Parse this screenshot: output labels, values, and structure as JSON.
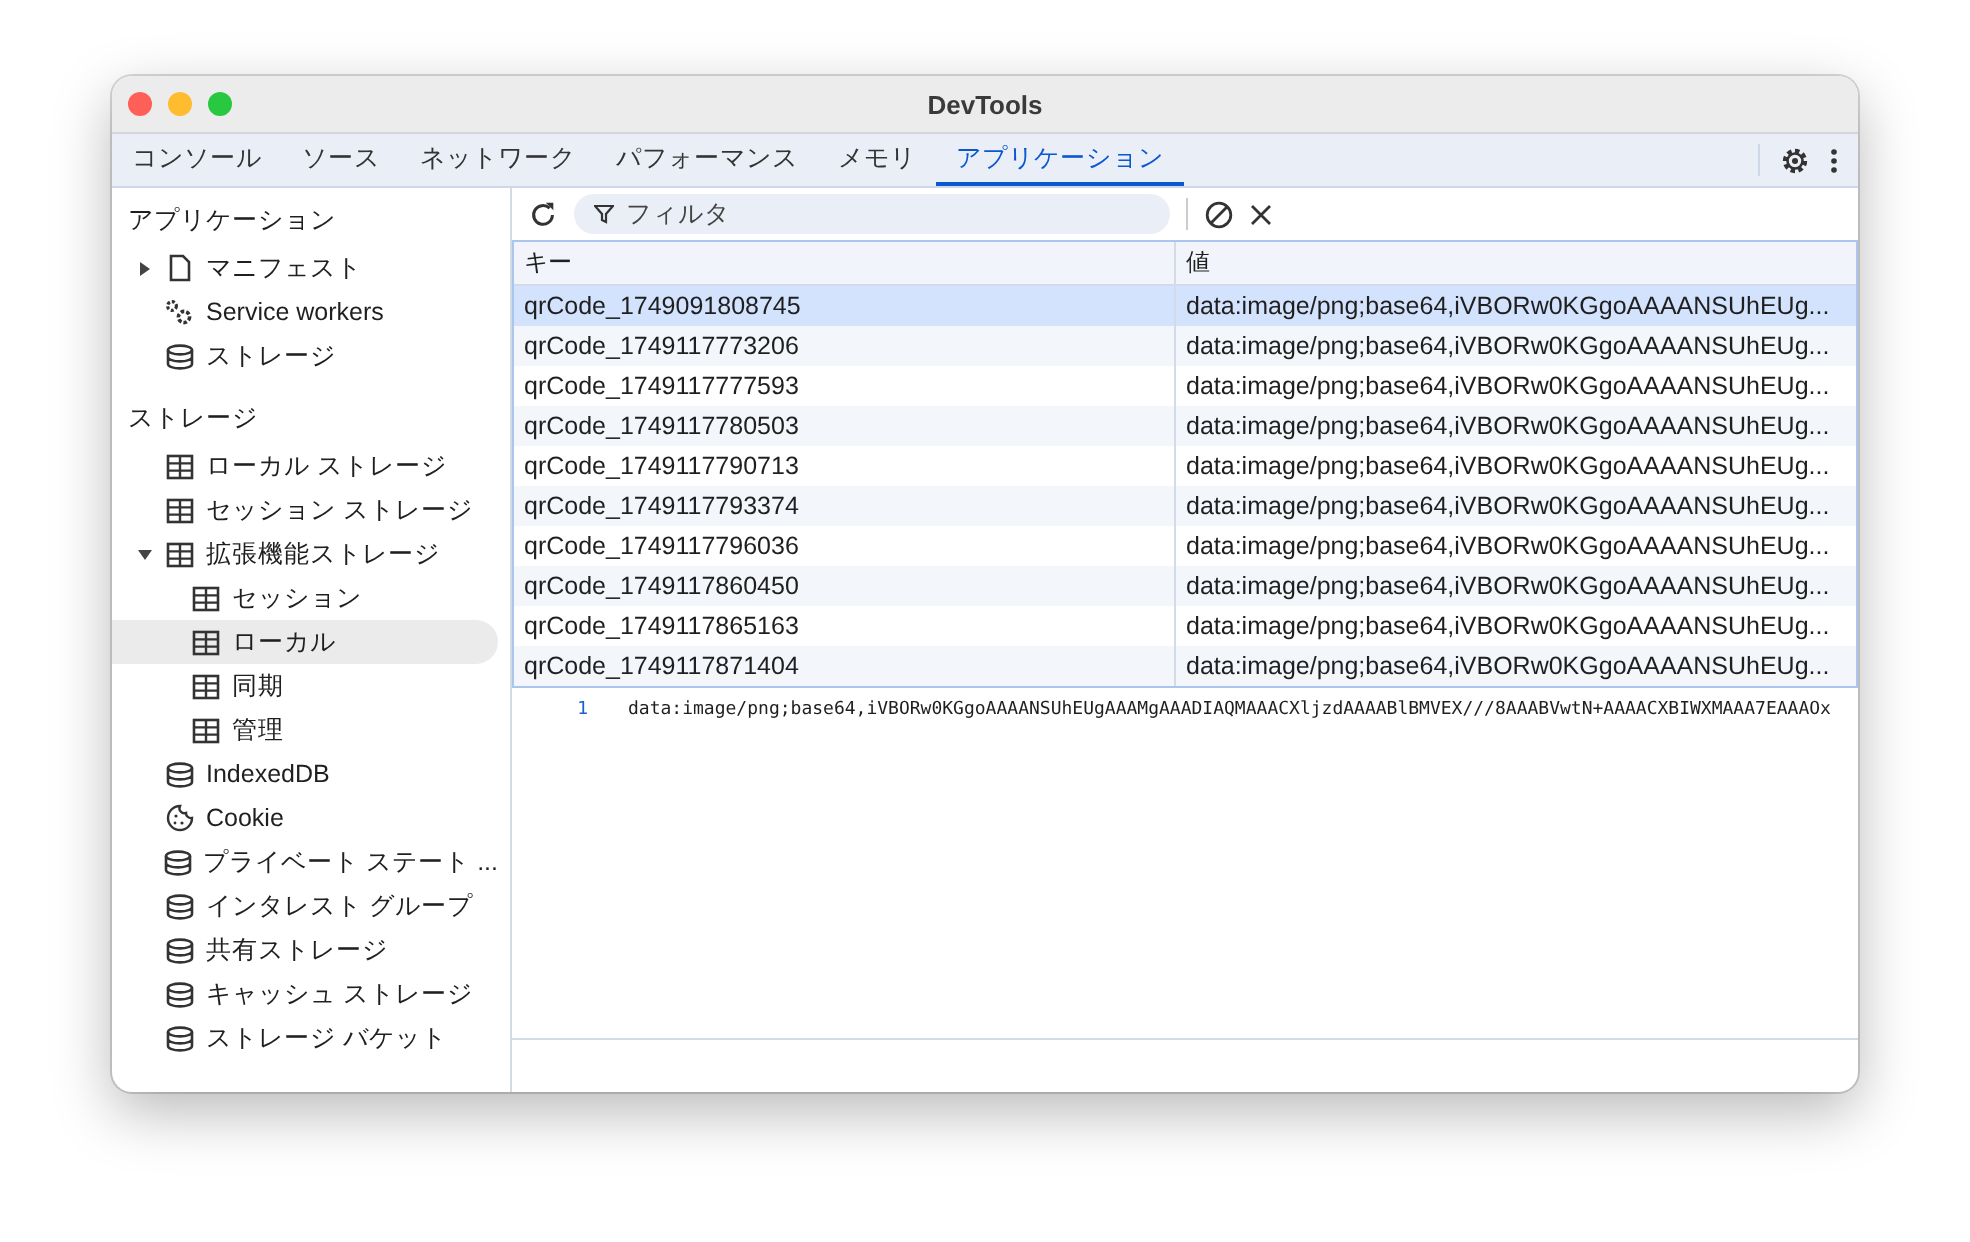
{
  "window": {
    "title": "DevTools"
  },
  "tabs": [
    {
      "label": "コンソール",
      "selected": false
    },
    {
      "label": "ソース",
      "selected": false
    },
    {
      "label": "ネットワーク",
      "selected": false
    },
    {
      "label": "パフォーマンス",
      "selected": false
    },
    {
      "label": "メモリ",
      "selected": false
    },
    {
      "label": "アプリケーション",
      "selected": true
    }
  ],
  "sidebar": {
    "sections": [
      {
        "title": "アプリケーション",
        "items": [
          {
            "label": "マニフェスト",
            "kind": "file",
            "selected": false,
            "expanded": false
          },
          {
            "label": "Service workers",
            "kind": "gear",
            "selected": false
          },
          {
            "label": "ストレージ",
            "kind": "database",
            "selected": false
          }
        ]
      },
      {
        "title": "ストレージ",
        "items": [
          {
            "label": "ローカル ストレージ",
            "kind": "table",
            "selected": false
          },
          {
            "label": "セッション ストレージ",
            "kind": "table",
            "selected": false
          },
          {
            "label": "拡張機能ストレージ",
            "kind": "table",
            "selected": false,
            "expanded": true,
            "children": [
              {
                "label": "セッション",
                "kind": "table",
                "selected": false
              },
              {
                "label": "ローカル",
                "kind": "table",
                "selected": true
              },
              {
                "label": "同期",
                "kind": "table",
                "selected": false
              },
              {
                "label": "管理",
                "kind": "table",
                "selected": false
              }
            ]
          },
          {
            "label": "IndexedDB",
            "kind": "database",
            "selected": false
          },
          {
            "label": "Cookie",
            "kind": "cookie",
            "selected": false
          },
          {
            "label": "プライベート ステート ...",
            "kind": "database",
            "selected": false
          },
          {
            "label": "インタレスト グループ",
            "kind": "database",
            "selected": false
          },
          {
            "label": "共有ストレージ",
            "kind": "database",
            "selected": false
          },
          {
            "label": "キャッシュ ストレージ",
            "kind": "database",
            "selected": false
          },
          {
            "label": "ストレージ バケット",
            "kind": "database",
            "selected": false
          }
        ]
      }
    ]
  },
  "toolbar": {
    "filter": {
      "placeholder": "フィルタ"
    }
  },
  "table": {
    "columns": [
      "キー",
      "値"
    ],
    "rows": [
      {
        "key": "qrCode_1749091808745",
        "value": "data:image/png;base64,iVBORw0KGgoAAAANSUhEUg...",
        "selected": true
      },
      {
        "key": "qrCode_1749117773206",
        "value": "data:image/png;base64,iVBORw0KGgoAAAANSUhEUg...",
        "selected": false
      },
      {
        "key": "qrCode_1749117777593",
        "value": "data:image/png;base64,iVBORw0KGgoAAAANSUhEUg...",
        "selected": false
      },
      {
        "key": "qrCode_1749117780503",
        "value": "data:image/png;base64,iVBORw0KGgoAAAANSUhEUg...",
        "selected": false
      },
      {
        "key": "qrCode_1749117790713",
        "value": "data:image/png;base64,iVBORw0KGgoAAAANSUhEUg...",
        "selected": false
      },
      {
        "key": "qrCode_1749117793374",
        "value": "data:image/png;base64,iVBORw0KGgoAAAANSUhEUg...",
        "selected": false
      },
      {
        "key": "qrCode_1749117796036",
        "value": "data:image/png;base64,iVBORw0KGgoAAAANSUhEUg...",
        "selected": false
      },
      {
        "key": "qrCode_1749117860450",
        "value": "data:image/png;base64,iVBORw0KGgoAAAANSUhEUg...",
        "selected": false
      },
      {
        "key": "qrCode_1749117865163",
        "value": "data:image/png;base64,iVBORw0KGgoAAAANSUhEUg...",
        "selected": false
      },
      {
        "key": "qrCode_1749117871404",
        "value": "data:image/png;base64,iVBORw0KGgoAAAANSUhEUg...",
        "selected": false
      }
    ]
  },
  "preview": {
    "lines": [
      {
        "number": "1",
        "text": "data:image/png;base64,iVBORw0KGgoAAAANSUhEUgAAAMgAAADIAQMAAACXljzdAAAABlBMVEX///8AAABVwtN+AAAACXBIWXMAAA7EAAAOx"
      }
    ]
  }
}
